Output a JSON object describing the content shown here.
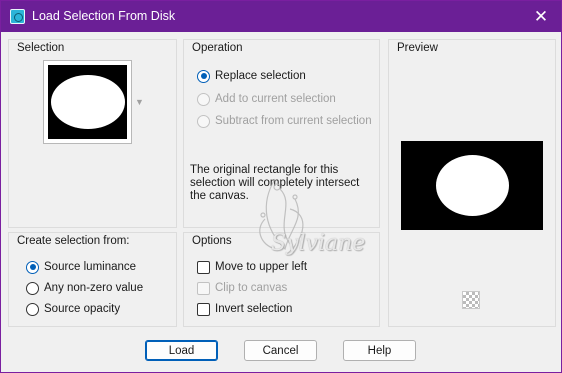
{
  "window": {
    "title": "Load Selection From Disk"
  },
  "selection": {
    "label": "Selection"
  },
  "operation": {
    "label": "Operation",
    "options": [
      {
        "label": "Replace selection",
        "checked": true,
        "disabled": false
      },
      {
        "label": "Add to current selection",
        "checked": false,
        "disabled": true
      },
      {
        "label": "Subtract from current selection",
        "checked": false,
        "disabled": true
      }
    ],
    "info_text": "The original rectangle for this selection will completely intersect the canvas."
  },
  "preview": {
    "label": "Preview"
  },
  "create_from": {
    "label": "Create selection from:",
    "options": [
      {
        "label": "Source luminance",
        "checked": true
      },
      {
        "label": "Any non-zero value",
        "checked": false
      },
      {
        "label": "Source opacity",
        "checked": false
      }
    ]
  },
  "options": {
    "label": "Options",
    "items": [
      {
        "label": "Move to upper left",
        "checked": false,
        "disabled": false
      },
      {
        "label": "Clip to canvas",
        "checked": false,
        "disabled": true
      },
      {
        "label": "Invert selection",
        "checked": false,
        "disabled": false
      }
    ]
  },
  "buttons": {
    "load": "Load",
    "cancel": "Cancel",
    "help": "Help"
  },
  "watermark": {
    "text": "Sylviane"
  },
  "icons": {
    "app": "app-icon",
    "close": "close-icon",
    "checker": "transparency-checker-icon"
  }
}
